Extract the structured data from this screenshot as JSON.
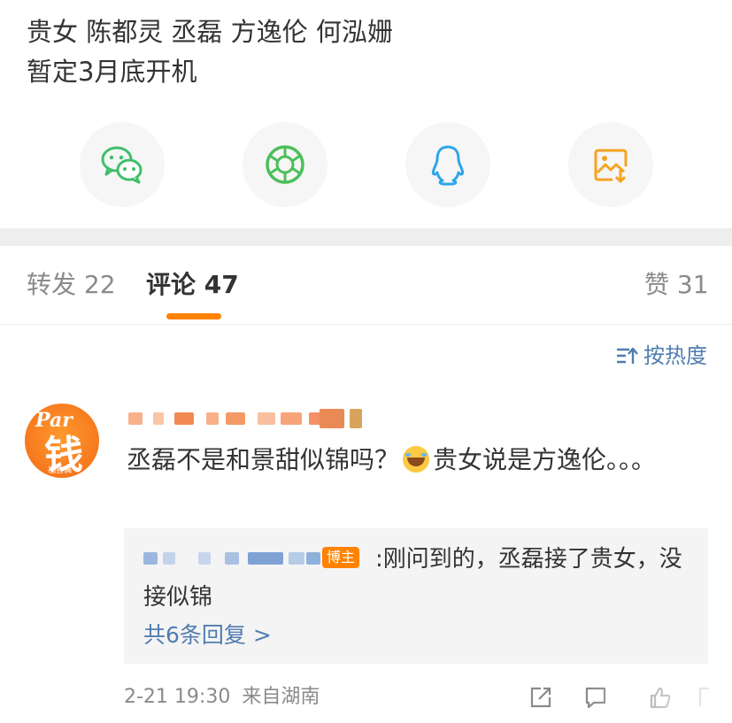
{
  "post": {
    "line1": "贵女 陈都灵 丞磊 方逸伦 何泓姗",
    "line2": "暂定3月底开机"
  },
  "share": [
    {
      "icon": "wechat-icon",
      "color": "#3fbf6a"
    },
    {
      "icon": "moments-icon",
      "color": "#4cbf5a"
    },
    {
      "icon": "qq-icon",
      "color": "#2fa4ea"
    },
    {
      "icon": "save-image-icon",
      "color": "#f6a321"
    }
  ],
  "tabs": {
    "repost": "转发 22",
    "comments": "评论 47",
    "likes": "赞 31"
  },
  "sort": {
    "label": "按热度"
  },
  "comment": {
    "text_before_emoji": "丞磊不是和景甜似锦吗？",
    "text_after_emoji": "贵女说是方逸伦。。。",
    "reply": {
      "badge": "博主",
      "text": ":刚问到的，丞磊接了贵女，没接似锦",
      "more": "共6条回复 >"
    },
    "time": "2-21 19:30",
    "source": "来自湖南"
  },
  "avatar": {
    "top": "Par",
    "main": "钱",
    "sub": "福喜满"
  },
  "colors": {
    "accent": "#ff8200",
    "link": "#507daf",
    "text": "#333333",
    "muted": "#8a8a8a"
  }
}
